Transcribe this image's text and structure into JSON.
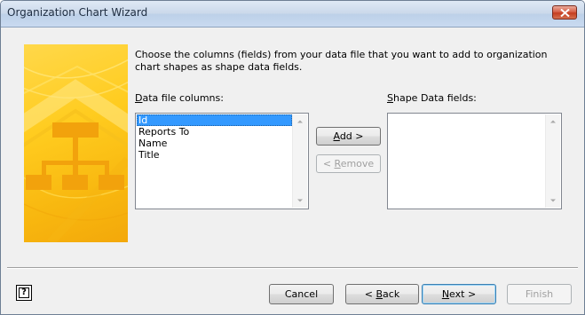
{
  "window": {
    "title": "Organization Chart Wizard"
  },
  "instruction": "Choose the columns (fields) from your data file that you want to add to organization chart shapes as shape data fields.",
  "data_file_columns": {
    "label_hotkey": "D",
    "label_rest": "ata file columns:",
    "items": [
      "Id",
      "Reports To",
      "Name",
      "Title"
    ],
    "selected_index": 0
  },
  "shape_data_fields": {
    "label_hotkey": "S",
    "label_rest": "hape Data fields:",
    "items": []
  },
  "buttons": {
    "add": {
      "hotkey": "A",
      "rest": "dd >"
    },
    "remove": {
      "prefix": "< ",
      "hotkey": "R",
      "rest": "emove"
    },
    "cancel": "Cancel",
    "back": {
      "prefix": "< ",
      "hotkey": "B",
      "rest": "ack"
    },
    "next": {
      "hotkey": "N",
      "rest": "ext >"
    },
    "finish": "Finish"
  },
  "help_icon_glyph": "?",
  "icons": [
    "close-icon",
    "help-icon",
    "scroll-up-icon",
    "scroll-down-icon",
    "org-chart-banner"
  ],
  "colors": {
    "selection": "#3399ff",
    "banner": "#ffcc1f",
    "close": "#c53d20"
  }
}
